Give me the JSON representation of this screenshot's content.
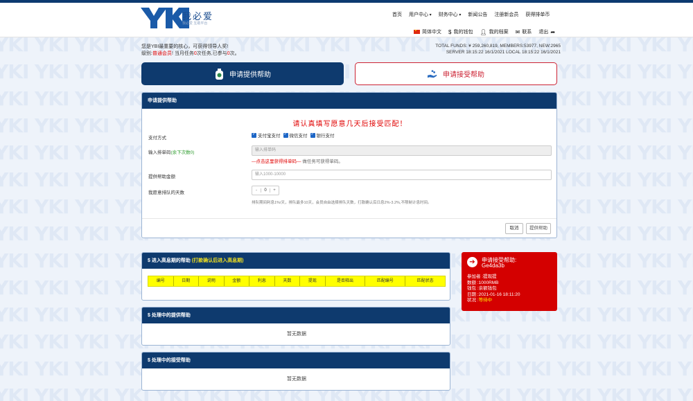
{
  "header": {
    "logo_text": "YKI",
    "logo_cn": "我必爱",
    "logo_sub": "我必爱 互助平台",
    "nav": [
      {
        "label": "首页",
        "dropdown": false
      },
      {
        "label": "用户中心",
        "dropdown": true
      },
      {
        "label": "财务中心",
        "dropdown": true
      },
      {
        "label": "新闻公告",
        "dropdown": false
      },
      {
        "label": "注册新会员",
        "dropdown": false
      },
      {
        "label": "获得排单币",
        "dropdown": false
      }
    ],
    "subnav": {
      "language": "简体中文",
      "wallet": "我的钱包",
      "profile": "我的档案",
      "contact": "联系",
      "logout": "退出"
    }
  },
  "welcome": {
    "line1": "您是YBI最重要的核心，可获得领导人奖!",
    "line2_prefix": "级别:",
    "line2_level": "普通会员",
    "line2_mid": "! 当月任务",
    "line2_tasks": "0",
    "line2_mid2": "次任务,已参与",
    "line2_done": "0",
    "line2_suffix": "次。"
  },
  "stats": {
    "line1": "TOTAL FUNDS: ¥ 259,260,819, MEMBERS:53977, NEW:2965",
    "line2": "SERVER  18:15:22 16/1/2021  LOCAL  18:15:22 16/1/2021"
  },
  "actions": {
    "provide_label": "申请提供帮助",
    "receive_label": "申请接受帮助"
  },
  "form": {
    "title": "申请提供帮助",
    "warning": "请认真填写愿意几天后接受匹配！",
    "payment_label": "支付方式",
    "payment_options": [
      "支付宝支付",
      "微信支付",
      "银行支付"
    ],
    "code_label": "输入排单码",
    "code_hint": "(余下次数0)",
    "code_placeholder": "输入排单码",
    "code_link": "—点击这里获得排单码—",
    "code_link_suffix": "做任务可获得单码。",
    "amount_label": "提供帮助金额",
    "amount_placeholder": "输入1000-10000",
    "days_label": "我愿意排队的天数",
    "days_minus": "-",
    "days_value": "0",
    "days_plus": "+",
    "days_note": "排队期间利息1%/天，排队最多10天，会员自由选择排队天数，打款确认后日息2%-3.2%,不限制计息时间。",
    "cancel_label": "取消",
    "submit_label": "提供帮助"
  },
  "high_interest": {
    "title": "$ 进入高息期的帮助",
    "note": "(打款确认后进入高息期)",
    "columns": [
      "编号",
      "日期",
      "说明",
      "金额",
      "利息",
      "天数",
      "提现",
      "是否释出",
      "匹配编号",
      "匹配状态"
    ]
  },
  "processing_provide": {
    "title": "$ 处理中的提供帮助",
    "empty": "暂无数据"
  },
  "processing_receive": {
    "title": "$ 处理中的接受帮助",
    "empty": "暂无数据"
  },
  "request_card": {
    "title": "申请接受帮助:",
    "code": "Ge4da3b",
    "participant": "参加者 :提现提",
    "amount": "数额 :1000RMB",
    "wallet": "钱包 :余额钱包",
    "date": "日期 :2021-01-16 18:11:20",
    "status_prefix": "状况 :",
    "status": "等待中"
  },
  "colors": {
    "navy": "#0e3a6e",
    "accent_red": "#d40000",
    "table_yellow": "#ffff00"
  }
}
